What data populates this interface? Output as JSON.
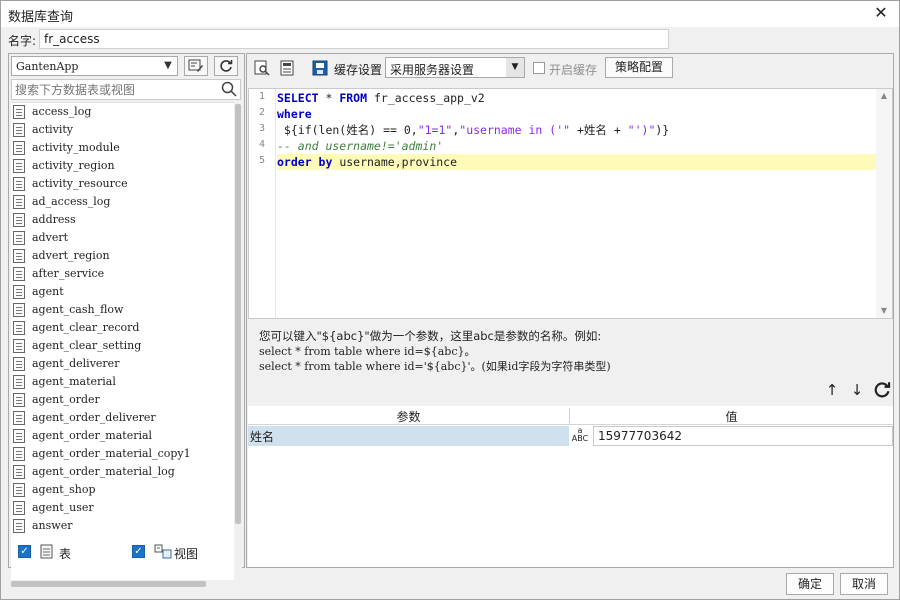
{
  "window": {
    "title": "数据库查询",
    "close_glyph": "✕"
  },
  "name_row": {
    "label": "名字:",
    "value": "fr_access"
  },
  "left": {
    "connection": "GantenApp",
    "search_placeholder": "搜索下方数据表或视图",
    "tables": [
      "access_log",
      "activity",
      "activity_module",
      "activity_region",
      "activity_resource",
      "ad_access_log",
      "address",
      "advert",
      "advert_region",
      "after_service",
      "agent",
      "agent_cash_flow",
      "agent_clear_record",
      "agent_clear_setting",
      "agent_deliverer",
      "agent_material",
      "agent_order",
      "agent_order_deliverer",
      "agent_order_material",
      "agent_order_material_copy1",
      "agent_order_material_log",
      "agent_shop",
      "agent_user",
      "answer"
    ],
    "footer": {
      "tables_label": "表",
      "views_label": "视图"
    }
  },
  "right": {
    "toolbar": {
      "cache_settings_label": "缓存设置",
      "server_setting_value": "采用服务器设置",
      "enable_cache_label": "开启缓存",
      "strategy_button": "策略配置"
    },
    "sql_lines": [
      "1",
      "2",
      "3",
      "4",
      "5"
    ],
    "help_lines": [
      "您可以键入\"${abc}\"做为一个参数，这里abc是参数的名称。例如:",
      "select * from table where id=${abc}。",
      "select * from table where id='${abc}'。(如果id字段为字符串类型)"
    ],
    "params": {
      "col_param": "参数",
      "col_value": "值",
      "rows": [
        {
          "name": "姓名",
          "type": "ABC",
          "value": "15977703642"
        }
      ]
    }
  },
  "buttons": {
    "ok": "确定",
    "cancel": "取消"
  }
}
